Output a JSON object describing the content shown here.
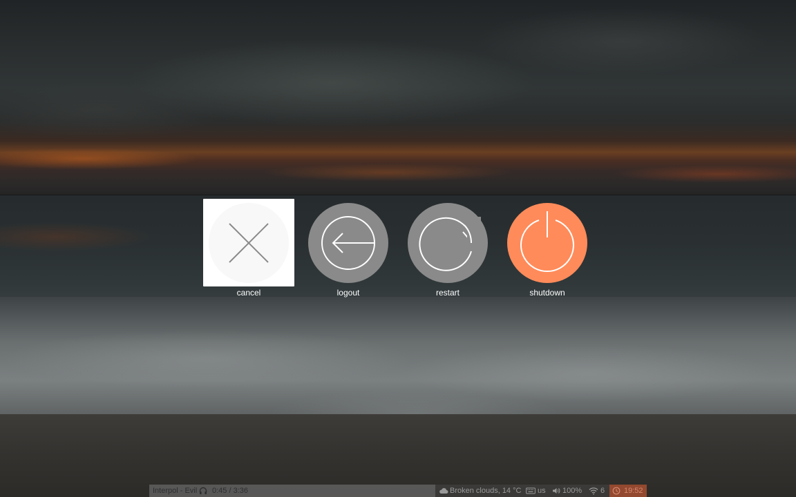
{
  "logout_dialog": {
    "options": [
      {
        "id": "cancel",
        "label": "cancel",
        "icon": "close-icon",
        "selected": true
      },
      {
        "id": "logout",
        "label": "logout",
        "icon": "logout-arrow-icon",
        "selected": false
      },
      {
        "id": "restart",
        "label": "restart",
        "icon": "restart-icon",
        "selected": false
      },
      {
        "id": "shutdown",
        "label": "shutdown",
        "icon": "power-icon",
        "selected": false
      }
    ],
    "colors": {
      "selected_tile": "#ffffff",
      "inactive_circle": "#8a8a8a",
      "shutdown_circle": "#ff8b5a",
      "icon_stroke": "#ffffff",
      "selected_icon_stroke": "#8a8a8a"
    }
  },
  "status_bar": {
    "now_playing": {
      "track": "Interpol - Evil",
      "icon": "headphones-icon",
      "time": "0:45 / 3:36"
    },
    "weather": {
      "icon": "cloud-icon",
      "text": "Broken clouds, 14 °C"
    },
    "keyboard": {
      "icon": "keyboard-icon",
      "layout": "us"
    },
    "volume": {
      "icon": "volume-icon",
      "level": "100%"
    },
    "wifi": {
      "icon": "wifi-icon",
      "value": "6"
    },
    "clock": {
      "icon": "clock-icon",
      "time": "19:52",
      "color": "#93492f"
    }
  }
}
